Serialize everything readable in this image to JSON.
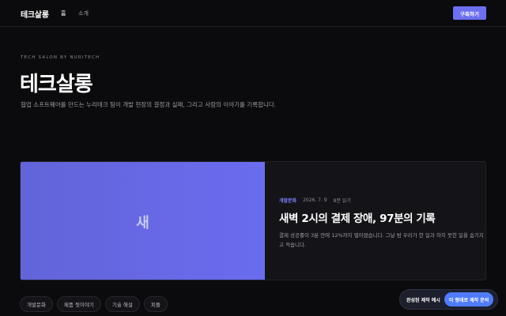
{
  "nav": {
    "brand": "테크살롱",
    "links": [
      {
        "label": "홈"
      },
      {
        "label": "소개"
      }
    ],
    "subscribe_label": "구독하기"
  },
  "hero": {
    "kicker": "TECH SALON BY NURITECH",
    "title": "테크살롱",
    "description": "협업 소프트웨어를 만드는 누리테크 팀이 개발 현장의 결정과 실패, 그리고 사람의 이야기를 기록합니다."
  },
  "featured": {
    "thumb_char": "새",
    "category": "개발문화",
    "date": "2026. 7. 9",
    "read_time": "8분 읽기",
    "title": "새벽 2시의 결제 장애, 97분의 기록",
    "excerpt": "결제 성공률이 3분 만에 12%까지 떨어졌습니다. 그날 밤 우리가 한 일과 하지 못한 일을 숨기지 않고 적습니다."
  },
  "categories": [
    "개발문화",
    "제품 뒷이야기",
    "기술 해설",
    "피플"
  ],
  "toast": {
    "label": "완성된 제작 예시",
    "button_label": "이 형태로 제작 문의"
  },
  "colors": {
    "background": "#0b0b0d",
    "accent": "#6c6ff2",
    "category_accent": "#7d80ff",
    "toast_button": "#4f7bff"
  }
}
